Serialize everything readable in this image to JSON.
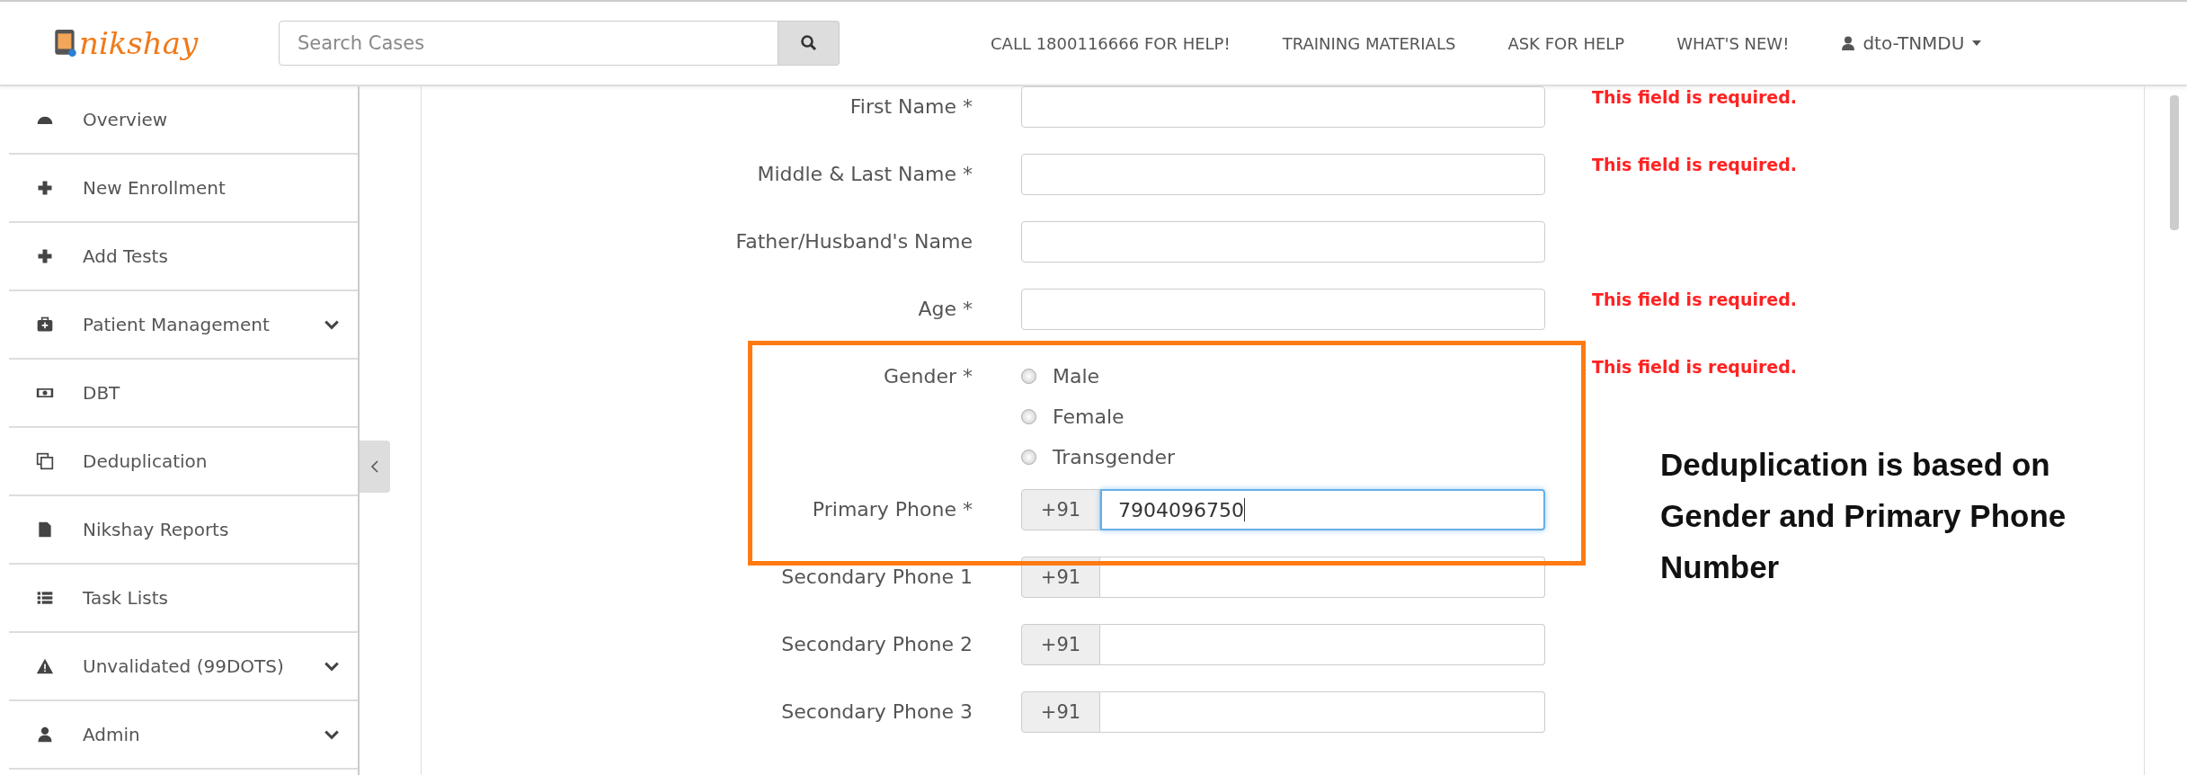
{
  "header": {
    "logo": "nikshay",
    "search": {
      "placeholder": "Search Cases"
    },
    "nav": [
      "CALL 1800116666 FOR HELP!",
      "TRAINING MATERIALS",
      "ASK FOR HELP",
      "WHAT'S NEW!"
    ],
    "user": "dto-TNMDU"
  },
  "sidebar": {
    "items": [
      {
        "label": "Overview",
        "expandable": false
      },
      {
        "label": "New Enrollment",
        "expandable": false
      },
      {
        "label": "Add Tests",
        "expandable": false
      },
      {
        "label": "Patient Management",
        "expandable": true
      },
      {
        "label": "DBT",
        "expandable": false
      },
      {
        "label": "Deduplication",
        "expandable": false
      },
      {
        "label": "Nikshay Reports",
        "expandable": false
      },
      {
        "label": "Task Lists",
        "expandable": false
      },
      {
        "label": "Unvalidated (99DOTS)",
        "expandable": true
      },
      {
        "label": "Admin",
        "expandable": true
      }
    ]
  },
  "form": {
    "fields": [
      {
        "kind": "text",
        "label": "First Name *",
        "error": "This field is required."
      },
      {
        "kind": "text",
        "label": "Middle & Last Name *",
        "error": "This field is required."
      },
      {
        "kind": "text",
        "label": "Father/Husband's Name"
      },
      {
        "kind": "text",
        "label": "Age *",
        "error": "This field is required."
      },
      {
        "kind": "radio",
        "label": "Gender *",
        "error": "This field is required.",
        "options": [
          {
            "label": "Male",
            "selected": false
          },
          {
            "label": "Female",
            "selected": false
          },
          {
            "label": "Transgender",
            "selected": false
          }
        ]
      },
      {
        "kind": "phone",
        "label": "Primary Phone *",
        "prefix": "+91",
        "value": "7904096750",
        "focused": true
      },
      {
        "kind": "phone",
        "label": "Secondary Phone 1",
        "prefix": "+91",
        "focused": false
      },
      {
        "kind": "phone",
        "label": "Secondary Phone 2",
        "prefix": "+91",
        "focused": false
      },
      {
        "kind": "phone",
        "label": "Secondary Phone 3",
        "prefix": "+91",
        "focused": false
      }
    ]
  },
  "annotation": {
    "text": "Deduplication is based on Gender and Primary Phone Number"
  }
}
